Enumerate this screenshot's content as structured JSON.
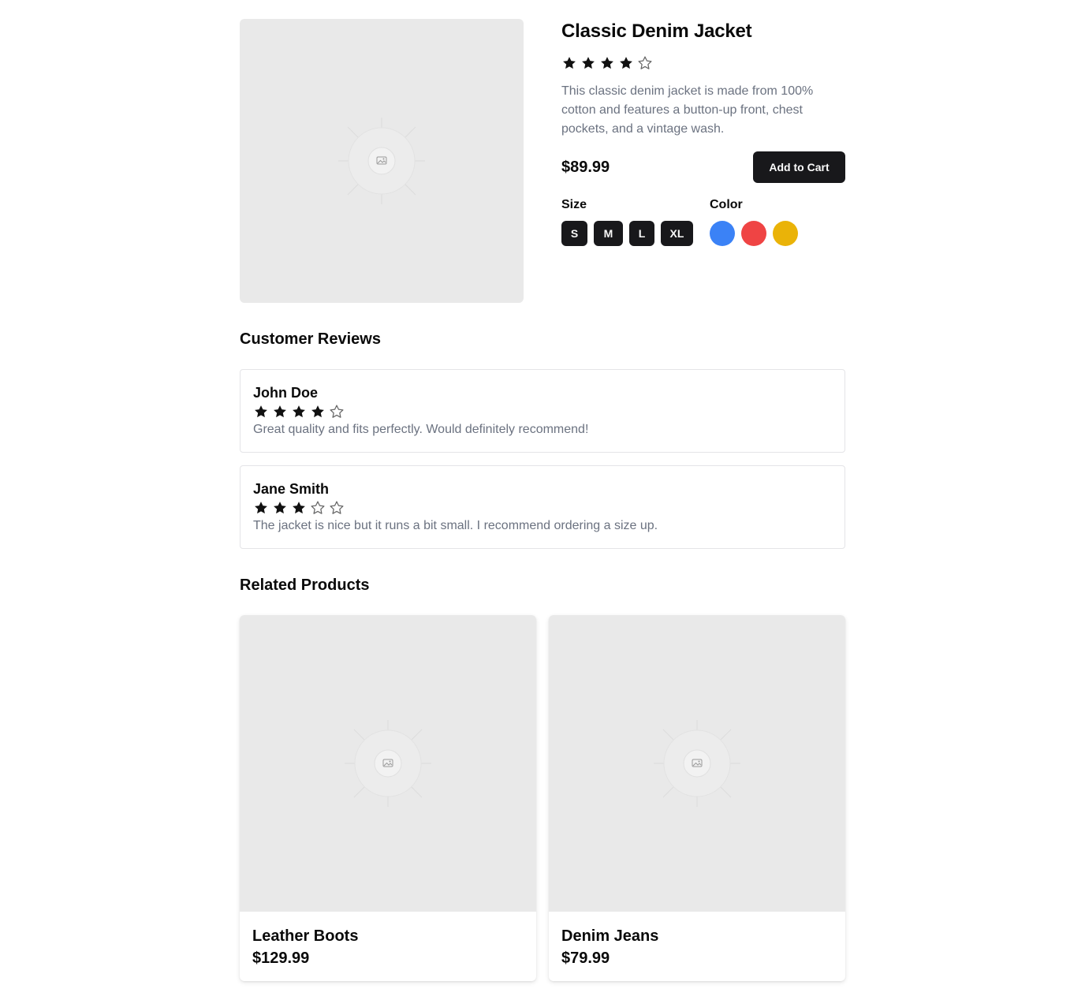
{
  "product": {
    "title": "Classic Denim Jacket",
    "rating": 4,
    "rating_max": 5,
    "description": "This classic denim jacket is made from 100% cotton and features a button-up front, chest pockets, and a vintage wash.",
    "price": "$89.99",
    "add_to_cart_label": "Add to Cart",
    "image_icon": "image-placeholder-icon"
  },
  "options": {
    "size_label": "Size",
    "sizes": [
      "S",
      "M",
      "L",
      "XL"
    ],
    "color_label": "Color",
    "colors": [
      "#3b82f6",
      "#ef4444",
      "#eab308"
    ]
  },
  "reviews": {
    "title": "Customer Reviews",
    "items": [
      {
        "name": "John Doe",
        "rating": 4,
        "text": "Great quality and fits perfectly. Would definitely recommend!"
      },
      {
        "name": "Jane Smith",
        "rating": 3,
        "text": "The jacket is nice but it runs a bit small. I recommend ordering a size up."
      }
    ]
  },
  "related": {
    "title": "Related Products",
    "items": [
      {
        "name": "Leather Boots",
        "price": "$129.99"
      },
      {
        "name": "Denim Jeans",
        "price": "$79.99"
      }
    ]
  },
  "colors": {
    "primary": "#18181b",
    "muted_text": "#6b7280",
    "placeholder_bg": "#e9e9e9",
    "star_fill": "#111111",
    "star_outline": "#666666"
  }
}
